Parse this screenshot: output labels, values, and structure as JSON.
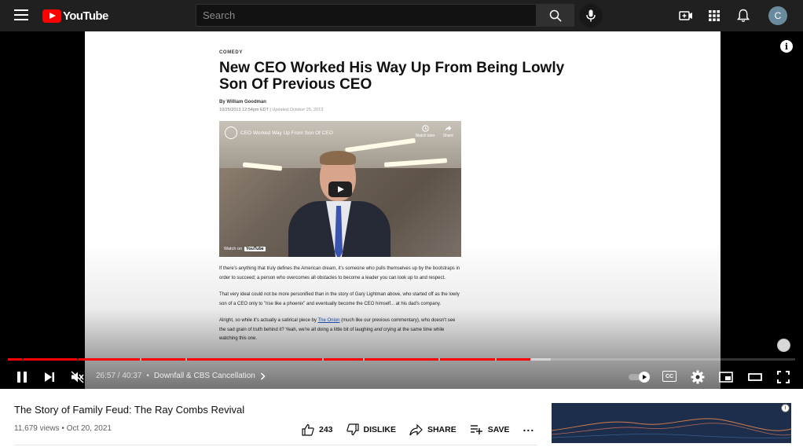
{
  "header": {
    "logo_text": "YouTube",
    "search_placeholder": "Search",
    "avatar_letter": "C"
  },
  "article": {
    "category": "COMEDY",
    "title": "New CEO Worked His Way Up From Being Lowly Son Of Previous CEO",
    "byline": "By William Goodman",
    "date": "10/25/2013 12:54pm EDT | ",
    "updated": "Updated October 25, 2013",
    "embed_title": "CEO Worked Way Up From Son Of CEO",
    "embed_watch_later": "Watch later",
    "embed_share": "Share",
    "embed_watch_on": "Watch on",
    "embed_yt": "YouTube",
    "p1": "If there's anything that truly defines the American dream, it's someone who pulls themselves up by the bootstraps in order to succeed; a person who overcomes all obstacles to become a leader you can look up to and respect.",
    "p2": "That very ideal could not be more personified than in the story of Gary Lightman above, who started off as the lowly son of a CEO only to \"rise like a phoenix\" and eventually become the CEO himself... at his dad's company.",
    "p3_a": "Alright, so while it's actually a satirical piece by ",
    "p3_link": "The Onion",
    "p3_b": " (much like our previous commentary), who doesn't see the sad grain of truth behind it? Yeah, we're all doing a little bit of laughing ",
    "p3_and": "and",
    "p3_c": " crying at the same time while watching this one."
  },
  "player": {
    "time_current": "26:57",
    "time_sep": " / ",
    "time_total": "40:37",
    "chapter": "Downfall & CBS Cancellation",
    "progress_fraction": 0.6636,
    "buffered_fraction": 0.69,
    "cc_label": "CC",
    "info_label": "i"
  },
  "video": {
    "title": "The Story of Family Feud: The Ray Combs Revival",
    "views": "11,679 views",
    "date": "Oct 20, 2021",
    "likes": "243",
    "dislike_label": "DISLIKE",
    "share_label": "SHARE",
    "save_label": "SAVE",
    "more_label": "..."
  },
  "ad": {
    "info_label": "i"
  },
  "colors": {
    "accent": "#ff0000",
    "topbar": "#202020",
    "link": "#1a55c5"
  }
}
